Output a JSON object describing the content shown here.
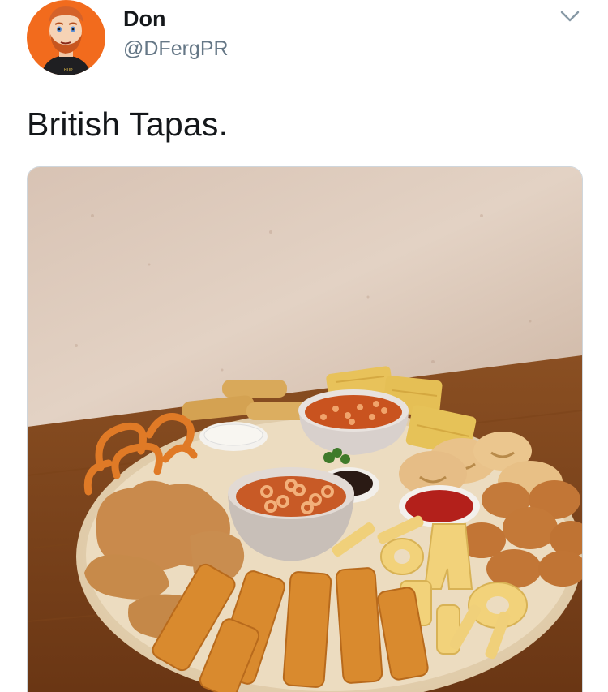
{
  "tweet": {
    "author_name": "Don",
    "author_handle": "@DFergPR",
    "text": "British Tapas.",
    "avatar_badge": "HUP"
  },
  "icons": {
    "menu": "chevron-down-icon"
  },
  "colors": {
    "avatar_bg": "#f26b1d",
    "handle": "#657786",
    "text": "#14171a"
  }
}
